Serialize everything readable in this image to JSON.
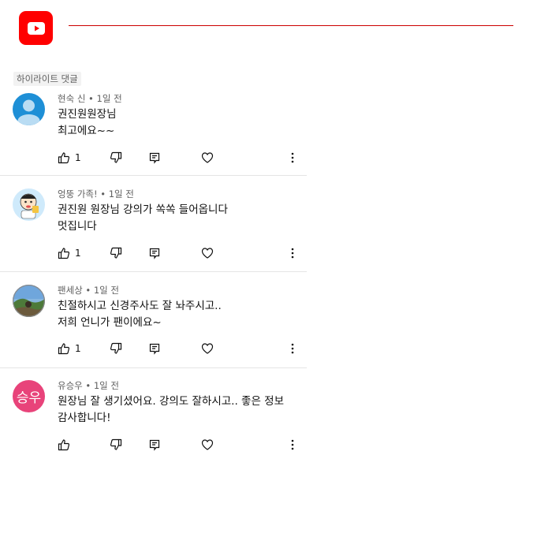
{
  "brand": {
    "logo_icon": "youtube-logo-icon",
    "color": "#ff0000"
  },
  "section_label": "하이라이트 댓글",
  "comments": [
    {
      "author": "현숙 신",
      "separator": " • ",
      "time": "1일 전",
      "lines": [
        "권진원원장님",
        "최고에요~~"
      ],
      "likes": "1",
      "avatar": {
        "type": "default-person",
        "color": "#2196d8"
      }
    },
    {
      "author": "엉뚱 가족!",
      "separator": " • ",
      "time": "1일 전",
      "lines": [
        "권진원 원장님 강의가 쏙쏙 들어옵니다",
        "멋집니다"
      ],
      "likes": "1",
      "avatar": {
        "type": "cartoon"
      }
    },
    {
      "author": "팬세상",
      "separator": " • ",
      "time": "1일 전",
      "lines": [
        "친절하시고 신경주사도 잘 놔주시고..",
        "저희 언니가 팬이에요~"
      ],
      "likes": "1",
      "avatar": {
        "type": "photo"
      }
    },
    {
      "author": "유승우",
      "separator": " • ",
      "time": "1일 전",
      "lines": [
        "원장님 잘 생기셨어요. 강의도 잘하시고.. 좋은 정보",
        "감사합니다!"
      ],
      "likes": "",
      "avatar": {
        "type": "initials",
        "text": "승우",
        "color": "#e8437a"
      }
    }
  ]
}
